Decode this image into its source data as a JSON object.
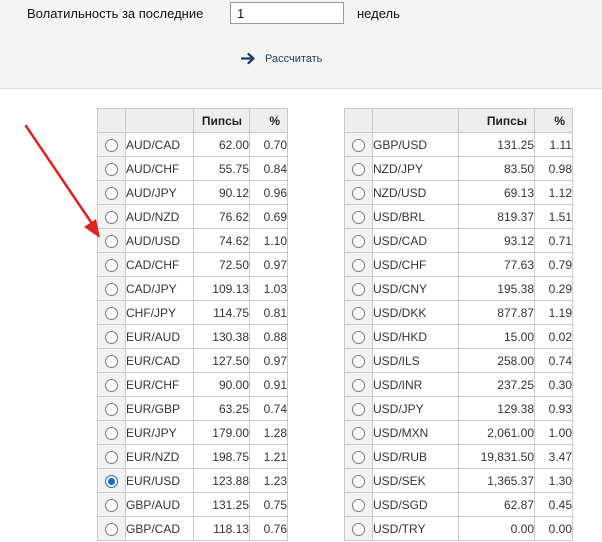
{
  "header": {
    "volatility_label": "Волатильность за последние",
    "period_value": "1",
    "period_unit": "недель",
    "calculate_label": "Рассчитать"
  },
  "colors": {
    "accent": "#1a64d6",
    "annotation": "#e0221c"
  },
  "tables": [
    {
      "columns": [
        "",
        "",
        "Пипсы",
        "%"
      ],
      "rows": [
        {
          "pair": "AUD/CAD",
          "pips": "62.00",
          "pct": "0.70",
          "selected": false
        },
        {
          "pair": "AUD/CHF",
          "pips": "55.75",
          "pct": "0.84",
          "selected": false
        },
        {
          "pair": "AUD/JPY",
          "pips": "90.12",
          "pct": "0.96",
          "selected": false
        },
        {
          "pair": "AUD/NZD",
          "pips": "76.62",
          "pct": "0.69",
          "selected": false
        },
        {
          "pair": "AUD/USD",
          "pips": "74.62",
          "pct": "1.10",
          "selected": false
        },
        {
          "pair": "CAD/CHF",
          "pips": "72.50",
          "pct": "0.97",
          "selected": false
        },
        {
          "pair": "CAD/JPY",
          "pips": "109.13",
          "pct": "1.03",
          "selected": false
        },
        {
          "pair": "CHF/JPY",
          "pips": "114.75",
          "pct": "0.81",
          "selected": false
        },
        {
          "pair": "EUR/AUD",
          "pips": "130.38",
          "pct": "0.88",
          "selected": false
        },
        {
          "pair": "EUR/CAD",
          "pips": "127.50",
          "pct": "0.97",
          "selected": false
        },
        {
          "pair": "EUR/CHF",
          "pips": "90.00",
          "pct": "0.91",
          "selected": false
        },
        {
          "pair": "EUR/GBP",
          "pips": "63.25",
          "pct": "0.74",
          "selected": false
        },
        {
          "pair": "EUR/JPY",
          "pips": "179.00",
          "pct": "1.28",
          "selected": false
        },
        {
          "pair": "EUR/NZD",
          "pips": "198.75",
          "pct": "1.21",
          "selected": false
        },
        {
          "pair": "EUR/USD",
          "pips": "123.88",
          "pct": "1.23",
          "selected": true
        },
        {
          "pair": "GBP/AUD",
          "pips": "131.25",
          "pct": "0.75",
          "selected": false
        },
        {
          "pair": "GBP/CAD",
          "pips": "118.13",
          "pct": "0.76",
          "selected": false
        }
      ]
    },
    {
      "columns": [
        "",
        "",
        "Пипсы",
        "%"
      ],
      "rows": [
        {
          "pair": "GBP/USD",
          "pips": "131.25",
          "pct": "1.11",
          "selected": false
        },
        {
          "pair": "NZD/JPY",
          "pips": "83.50",
          "pct": "0.98",
          "selected": false
        },
        {
          "pair": "NZD/USD",
          "pips": "69.13",
          "pct": "1.12",
          "selected": false
        },
        {
          "pair": "USD/BRL",
          "pips": "819.37",
          "pct": "1.51",
          "selected": false
        },
        {
          "pair": "USD/CAD",
          "pips": "93.12",
          "pct": "0.71",
          "selected": false
        },
        {
          "pair": "USD/CHF",
          "pips": "77.63",
          "pct": "0.79",
          "selected": false
        },
        {
          "pair": "USD/CNY",
          "pips": "195.38",
          "pct": "0.29",
          "selected": false
        },
        {
          "pair": "USD/DKK",
          "pips": "877.87",
          "pct": "1.19",
          "selected": false
        },
        {
          "pair": "USD/HKD",
          "pips": "15.00",
          "pct": "0.02",
          "selected": false
        },
        {
          "pair": "USD/ILS",
          "pips": "258.00",
          "pct": "0.74",
          "selected": false
        },
        {
          "pair": "USD/INR",
          "pips": "237.25",
          "pct": "0.30",
          "selected": false
        },
        {
          "pair": "USD/JPY",
          "pips": "129.38",
          "pct": "0.93",
          "selected": false
        },
        {
          "pair": "USD/MXN",
          "pips": "2,061.00",
          "pct": "1.00",
          "selected": false
        },
        {
          "pair": "USD/RUB",
          "pips": "19,831.50",
          "pct": "3.47",
          "selected": false
        },
        {
          "pair": "USD/SEK",
          "pips": "1,365.37",
          "pct": "1.30",
          "selected": false
        },
        {
          "pair": "USD/SGD",
          "pips": "62.87",
          "pct": "0.45",
          "selected": false
        },
        {
          "pair": "USD/TRY",
          "pips": "0.00",
          "pct": "0.00",
          "selected": false
        }
      ]
    }
  ]
}
